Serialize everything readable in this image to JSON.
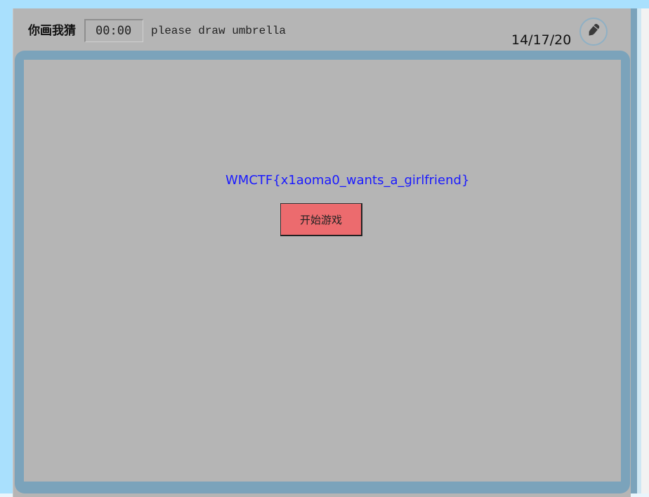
{
  "header": {
    "title": "你画我猜",
    "timer": "00:00",
    "prompt": "please draw umbrella",
    "score": "14/17/20",
    "pencil_icon": "pencil-icon"
  },
  "canvas": {
    "flag_text": "WMCTF{x1aoma0_wants_a_girlfriend}",
    "start_button_label": "开始游戏"
  },
  "colors": {
    "page_background": "#a9e0fd",
    "panel_background": "#b5b5b5",
    "canvas_border": "#7ba3bb",
    "flag_text": "#1a1aff",
    "start_button": "#ec6b6e"
  }
}
